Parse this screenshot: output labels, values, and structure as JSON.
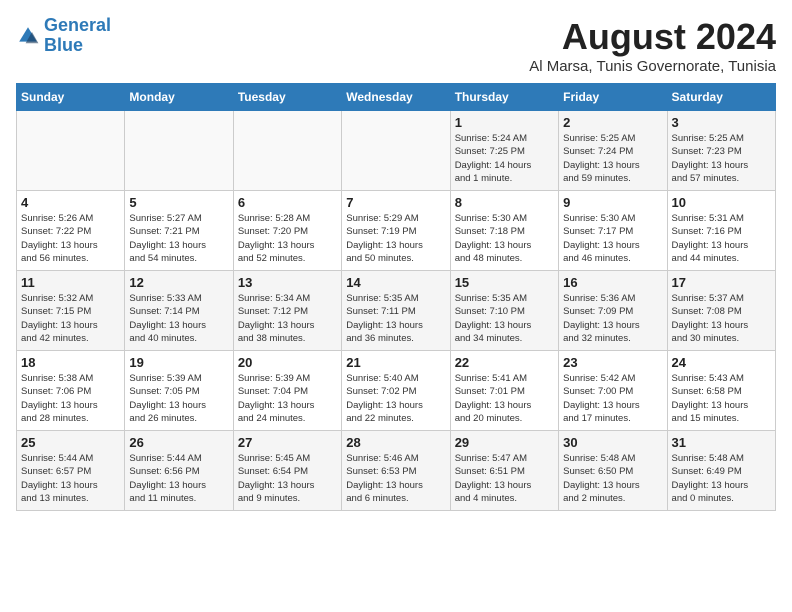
{
  "logo": {
    "line1": "General",
    "line2": "Blue"
  },
  "title": "August 2024",
  "subtitle": "Al Marsa, Tunis Governorate, Tunisia",
  "weekdays": [
    "Sunday",
    "Monday",
    "Tuesday",
    "Wednesday",
    "Thursday",
    "Friday",
    "Saturday"
  ],
  "weeks": [
    [
      {
        "day": "",
        "info": ""
      },
      {
        "day": "",
        "info": ""
      },
      {
        "day": "",
        "info": ""
      },
      {
        "day": "",
        "info": ""
      },
      {
        "day": "1",
        "info": "Sunrise: 5:24 AM\nSunset: 7:25 PM\nDaylight: 14 hours\nand 1 minute."
      },
      {
        "day": "2",
        "info": "Sunrise: 5:25 AM\nSunset: 7:24 PM\nDaylight: 13 hours\nand 59 minutes."
      },
      {
        "day": "3",
        "info": "Sunrise: 5:25 AM\nSunset: 7:23 PM\nDaylight: 13 hours\nand 57 minutes."
      }
    ],
    [
      {
        "day": "4",
        "info": "Sunrise: 5:26 AM\nSunset: 7:22 PM\nDaylight: 13 hours\nand 56 minutes."
      },
      {
        "day": "5",
        "info": "Sunrise: 5:27 AM\nSunset: 7:21 PM\nDaylight: 13 hours\nand 54 minutes."
      },
      {
        "day": "6",
        "info": "Sunrise: 5:28 AM\nSunset: 7:20 PM\nDaylight: 13 hours\nand 52 minutes."
      },
      {
        "day": "7",
        "info": "Sunrise: 5:29 AM\nSunset: 7:19 PM\nDaylight: 13 hours\nand 50 minutes."
      },
      {
        "day": "8",
        "info": "Sunrise: 5:30 AM\nSunset: 7:18 PM\nDaylight: 13 hours\nand 48 minutes."
      },
      {
        "day": "9",
        "info": "Sunrise: 5:30 AM\nSunset: 7:17 PM\nDaylight: 13 hours\nand 46 minutes."
      },
      {
        "day": "10",
        "info": "Sunrise: 5:31 AM\nSunset: 7:16 PM\nDaylight: 13 hours\nand 44 minutes."
      }
    ],
    [
      {
        "day": "11",
        "info": "Sunrise: 5:32 AM\nSunset: 7:15 PM\nDaylight: 13 hours\nand 42 minutes."
      },
      {
        "day": "12",
        "info": "Sunrise: 5:33 AM\nSunset: 7:14 PM\nDaylight: 13 hours\nand 40 minutes."
      },
      {
        "day": "13",
        "info": "Sunrise: 5:34 AM\nSunset: 7:12 PM\nDaylight: 13 hours\nand 38 minutes."
      },
      {
        "day": "14",
        "info": "Sunrise: 5:35 AM\nSunset: 7:11 PM\nDaylight: 13 hours\nand 36 minutes."
      },
      {
        "day": "15",
        "info": "Sunrise: 5:35 AM\nSunset: 7:10 PM\nDaylight: 13 hours\nand 34 minutes."
      },
      {
        "day": "16",
        "info": "Sunrise: 5:36 AM\nSunset: 7:09 PM\nDaylight: 13 hours\nand 32 minutes."
      },
      {
        "day": "17",
        "info": "Sunrise: 5:37 AM\nSunset: 7:08 PM\nDaylight: 13 hours\nand 30 minutes."
      }
    ],
    [
      {
        "day": "18",
        "info": "Sunrise: 5:38 AM\nSunset: 7:06 PM\nDaylight: 13 hours\nand 28 minutes."
      },
      {
        "day": "19",
        "info": "Sunrise: 5:39 AM\nSunset: 7:05 PM\nDaylight: 13 hours\nand 26 minutes."
      },
      {
        "day": "20",
        "info": "Sunrise: 5:39 AM\nSunset: 7:04 PM\nDaylight: 13 hours\nand 24 minutes."
      },
      {
        "day": "21",
        "info": "Sunrise: 5:40 AM\nSunset: 7:02 PM\nDaylight: 13 hours\nand 22 minutes."
      },
      {
        "day": "22",
        "info": "Sunrise: 5:41 AM\nSunset: 7:01 PM\nDaylight: 13 hours\nand 20 minutes."
      },
      {
        "day": "23",
        "info": "Sunrise: 5:42 AM\nSunset: 7:00 PM\nDaylight: 13 hours\nand 17 minutes."
      },
      {
        "day": "24",
        "info": "Sunrise: 5:43 AM\nSunset: 6:58 PM\nDaylight: 13 hours\nand 15 minutes."
      }
    ],
    [
      {
        "day": "25",
        "info": "Sunrise: 5:44 AM\nSunset: 6:57 PM\nDaylight: 13 hours\nand 13 minutes."
      },
      {
        "day": "26",
        "info": "Sunrise: 5:44 AM\nSunset: 6:56 PM\nDaylight: 13 hours\nand 11 minutes."
      },
      {
        "day": "27",
        "info": "Sunrise: 5:45 AM\nSunset: 6:54 PM\nDaylight: 13 hours\nand 9 minutes."
      },
      {
        "day": "28",
        "info": "Sunrise: 5:46 AM\nSunset: 6:53 PM\nDaylight: 13 hours\nand 6 minutes."
      },
      {
        "day": "29",
        "info": "Sunrise: 5:47 AM\nSunset: 6:51 PM\nDaylight: 13 hours\nand 4 minutes."
      },
      {
        "day": "30",
        "info": "Sunrise: 5:48 AM\nSunset: 6:50 PM\nDaylight: 13 hours\nand 2 minutes."
      },
      {
        "day": "31",
        "info": "Sunrise: 5:48 AM\nSunset: 6:49 PM\nDaylight: 13 hours\nand 0 minutes."
      }
    ]
  ]
}
